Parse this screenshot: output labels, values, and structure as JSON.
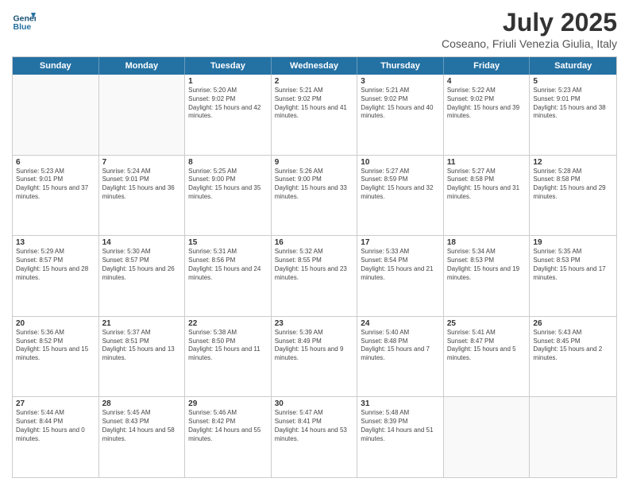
{
  "header": {
    "logo_line1": "General",
    "logo_line2": "Blue",
    "month": "July 2025",
    "location": "Coseano, Friuli Venezia Giulia, Italy"
  },
  "days": [
    "Sunday",
    "Monday",
    "Tuesday",
    "Wednesday",
    "Thursday",
    "Friday",
    "Saturday"
  ],
  "rows": [
    [
      {
        "date": "",
        "info": ""
      },
      {
        "date": "",
        "info": ""
      },
      {
        "date": "1",
        "info": "Sunrise: 5:20 AM\nSunset: 9:02 PM\nDaylight: 15 hours and 42 minutes."
      },
      {
        "date": "2",
        "info": "Sunrise: 5:21 AM\nSunset: 9:02 PM\nDaylight: 15 hours and 41 minutes."
      },
      {
        "date": "3",
        "info": "Sunrise: 5:21 AM\nSunset: 9:02 PM\nDaylight: 15 hours and 40 minutes."
      },
      {
        "date": "4",
        "info": "Sunrise: 5:22 AM\nSunset: 9:02 PM\nDaylight: 15 hours and 39 minutes."
      },
      {
        "date": "5",
        "info": "Sunrise: 5:23 AM\nSunset: 9:01 PM\nDaylight: 15 hours and 38 minutes."
      }
    ],
    [
      {
        "date": "6",
        "info": "Sunrise: 5:23 AM\nSunset: 9:01 PM\nDaylight: 15 hours and 37 minutes."
      },
      {
        "date": "7",
        "info": "Sunrise: 5:24 AM\nSunset: 9:01 PM\nDaylight: 15 hours and 36 minutes."
      },
      {
        "date": "8",
        "info": "Sunrise: 5:25 AM\nSunset: 9:00 PM\nDaylight: 15 hours and 35 minutes."
      },
      {
        "date": "9",
        "info": "Sunrise: 5:26 AM\nSunset: 9:00 PM\nDaylight: 15 hours and 33 minutes."
      },
      {
        "date": "10",
        "info": "Sunrise: 5:27 AM\nSunset: 8:59 PM\nDaylight: 15 hours and 32 minutes."
      },
      {
        "date": "11",
        "info": "Sunrise: 5:27 AM\nSunset: 8:58 PM\nDaylight: 15 hours and 31 minutes."
      },
      {
        "date": "12",
        "info": "Sunrise: 5:28 AM\nSunset: 8:58 PM\nDaylight: 15 hours and 29 minutes."
      }
    ],
    [
      {
        "date": "13",
        "info": "Sunrise: 5:29 AM\nSunset: 8:57 PM\nDaylight: 15 hours and 28 minutes."
      },
      {
        "date": "14",
        "info": "Sunrise: 5:30 AM\nSunset: 8:57 PM\nDaylight: 15 hours and 26 minutes."
      },
      {
        "date": "15",
        "info": "Sunrise: 5:31 AM\nSunset: 8:56 PM\nDaylight: 15 hours and 24 minutes."
      },
      {
        "date": "16",
        "info": "Sunrise: 5:32 AM\nSunset: 8:55 PM\nDaylight: 15 hours and 23 minutes."
      },
      {
        "date": "17",
        "info": "Sunrise: 5:33 AM\nSunset: 8:54 PM\nDaylight: 15 hours and 21 minutes."
      },
      {
        "date": "18",
        "info": "Sunrise: 5:34 AM\nSunset: 8:53 PM\nDaylight: 15 hours and 19 minutes."
      },
      {
        "date": "19",
        "info": "Sunrise: 5:35 AM\nSunset: 8:53 PM\nDaylight: 15 hours and 17 minutes."
      }
    ],
    [
      {
        "date": "20",
        "info": "Sunrise: 5:36 AM\nSunset: 8:52 PM\nDaylight: 15 hours and 15 minutes."
      },
      {
        "date": "21",
        "info": "Sunrise: 5:37 AM\nSunset: 8:51 PM\nDaylight: 15 hours and 13 minutes."
      },
      {
        "date": "22",
        "info": "Sunrise: 5:38 AM\nSunset: 8:50 PM\nDaylight: 15 hours and 11 minutes."
      },
      {
        "date": "23",
        "info": "Sunrise: 5:39 AM\nSunset: 8:49 PM\nDaylight: 15 hours and 9 minutes."
      },
      {
        "date": "24",
        "info": "Sunrise: 5:40 AM\nSunset: 8:48 PM\nDaylight: 15 hours and 7 minutes."
      },
      {
        "date": "25",
        "info": "Sunrise: 5:41 AM\nSunset: 8:47 PM\nDaylight: 15 hours and 5 minutes."
      },
      {
        "date": "26",
        "info": "Sunrise: 5:43 AM\nSunset: 8:45 PM\nDaylight: 15 hours and 2 minutes."
      }
    ],
    [
      {
        "date": "27",
        "info": "Sunrise: 5:44 AM\nSunset: 8:44 PM\nDaylight: 15 hours and 0 minutes."
      },
      {
        "date": "28",
        "info": "Sunrise: 5:45 AM\nSunset: 8:43 PM\nDaylight: 14 hours and 58 minutes."
      },
      {
        "date": "29",
        "info": "Sunrise: 5:46 AM\nSunset: 8:42 PM\nDaylight: 14 hours and 55 minutes."
      },
      {
        "date": "30",
        "info": "Sunrise: 5:47 AM\nSunset: 8:41 PM\nDaylight: 14 hours and 53 minutes."
      },
      {
        "date": "31",
        "info": "Sunrise: 5:48 AM\nSunset: 8:39 PM\nDaylight: 14 hours and 51 minutes."
      },
      {
        "date": "",
        "info": ""
      },
      {
        "date": "",
        "info": ""
      }
    ]
  ]
}
